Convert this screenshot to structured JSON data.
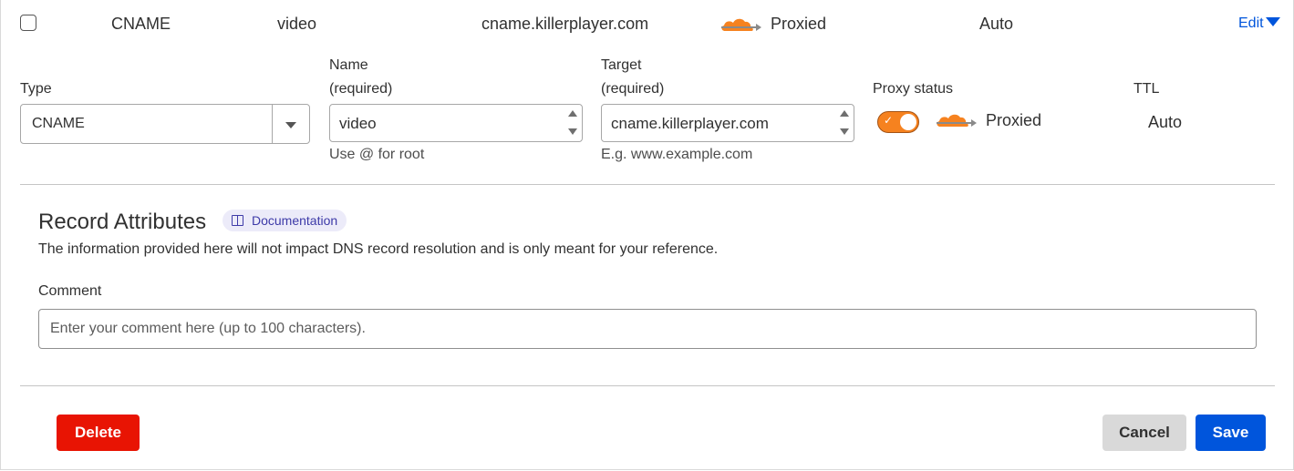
{
  "summary": {
    "type": "CNAME",
    "name": "video",
    "content": "cname.killerplayer.com",
    "proxy_status": "Proxied",
    "ttl": "Auto",
    "edit_label": "Edit"
  },
  "form": {
    "type_label": "Type",
    "type_value": "CNAME",
    "name_label": "Name",
    "name_required": "(required)",
    "name_value": "video",
    "name_help": "Use @ for root",
    "target_label": "Target",
    "target_required": "(required)",
    "target_value": "cname.killerplayer.com",
    "target_help": "E.g. www.example.com",
    "proxy_label": "Proxy status",
    "proxy_value": "Proxied",
    "proxy_enabled": true,
    "ttl_label": "TTL",
    "ttl_value": "Auto"
  },
  "attributes": {
    "heading": "Record Attributes",
    "doc_label": "Documentation",
    "description": "The information provided here will not impact DNS record resolution and is only meant for your reference.",
    "comment_label": "Comment",
    "comment_placeholder": "Enter your comment here (up to 100 characters).",
    "comment_value": ""
  },
  "actions": {
    "delete_label": "Delete",
    "cancel_label": "Cancel",
    "save_label": "Save"
  },
  "colors": {
    "accent": "#0055dc",
    "danger": "#e81403",
    "cloud": "#f6821f"
  },
  "icons": [
    "checkbox-icon",
    "cloud-proxied-icon",
    "chevron-down-icon",
    "book-icon",
    "check-icon"
  ]
}
